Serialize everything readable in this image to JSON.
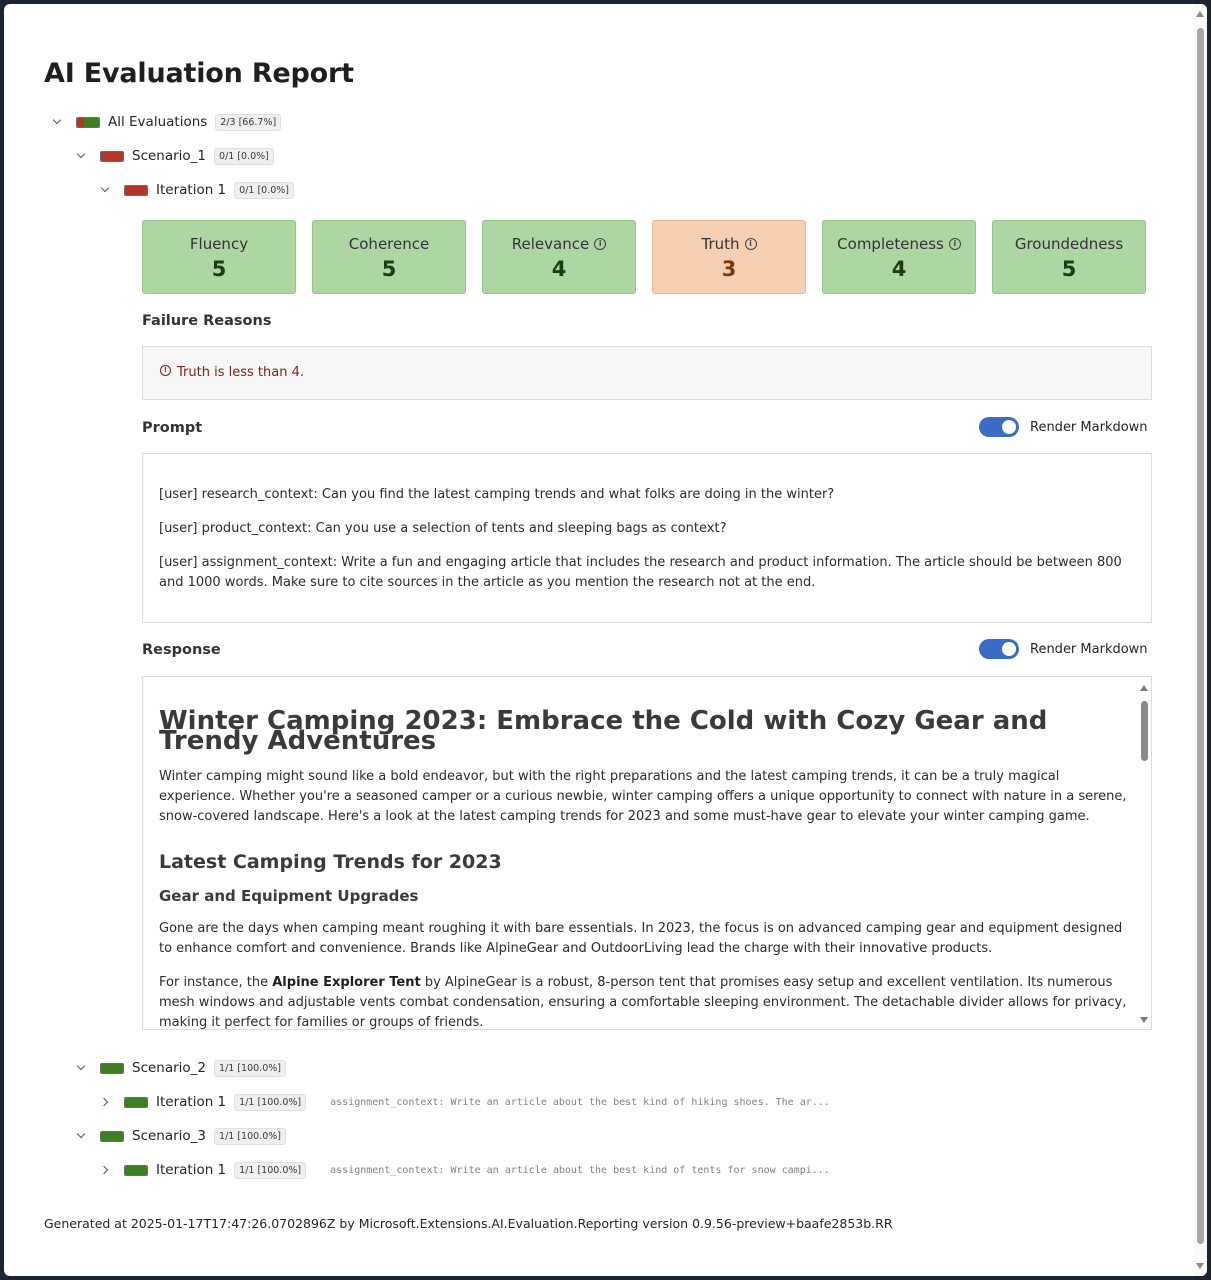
{
  "page_title": "AI Evaluation Report",
  "tree": {
    "root": {
      "label": "All Evaluations",
      "badge": "2/3 [66.7%]"
    },
    "scenario1": {
      "label": "Scenario_1",
      "badge": "0/1 [0.0%]"
    },
    "scenario1_iteration": {
      "label": "Iteration 1",
      "badge": "0/1 [0.0%]"
    },
    "scenario2": {
      "label": "Scenario_2",
      "badge": "1/1 [100.0%]"
    },
    "scenario2_iteration": {
      "label": "Iteration 1",
      "badge": "1/1 [100.0%]",
      "preview": "assignment_context: Write an article about the best kind of hiking shoes. The ar..."
    },
    "scenario3": {
      "label": "Scenario_3",
      "badge": "1/1 [100.0%]"
    },
    "scenario3_iteration": {
      "label": "Iteration 1",
      "badge": "1/1 [100.0%]",
      "preview": "assignment_context: Write an article about the best kind of tents for snow campi..."
    }
  },
  "metrics": [
    {
      "name": "Fluency",
      "score": "5",
      "status": "pass",
      "info": false
    },
    {
      "name": "Coherence",
      "score": "5",
      "status": "pass",
      "info": false
    },
    {
      "name": "Relevance",
      "score": "4",
      "status": "pass",
      "info": true
    },
    {
      "name": "Truth",
      "score": "3",
      "status": "fail",
      "info": true
    },
    {
      "name": "Completeness",
      "score": "4",
      "status": "pass",
      "info": true
    },
    {
      "name": "Groundedness",
      "score": "5",
      "status": "pass",
      "info": false
    }
  ],
  "failure": {
    "title": "Failure Reasons",
    "reason": "Truth is less than 4."
  },
  "prompt": {
    "title": "Prompt",
    "toggle_label": "Render Markdown",
    "lines": [
      "[user] research_context: Can you find the latest camping trends and what folks are doing in the winter?",
      "[user] product_context: Can you use a selection of tents and sleeping bags as context?",
      "[user] assignment_context: Write a fun and engaging article that includes the research and product information. The article should be between 800 and 1000 words. Make sure to cite sources in the article as you mention the research not at the end."
    ]
  },
  "response": {
    "title": "Response",
    "toggle_label": "Render Markdown",
    "heading": "Winter Camping 2023: Embrace the Cold with Cozy Gear and Trendy Adventures",
    "intro": "Winter camping might sound like a bold endeavor, but with the right preparations and the latest camping trends, it can be a truly magical experience. Whether you're a seasoned camper or a curious newbie, winter camping offers a unique opportunity to connect with nature in a serene, snow-covered landscape. Here's a look at the latest camping trends for 2023 and some must-have gear to elevate your winter camping game.",
    "section_heading": "Latest Camping Trends for 2023",
    "subsection_heading": "Gear and Equipment Upgrades",
    "paragraph1": "Gone are the days when camping meant roughing it with bare essentials. In 2023, the focus is on advanced camping gear and equipment designed to enhance comfort and convenience. Brands like AlpineGear and OutdoorLiving lead the charge with their innovative products.",
    "paragraph2_before": "For instance, the ",
    "paragraph2_bold": "Alpine Explorer Tent",
    "paragraph2_after": " by AlpineGear is a robust, 8-person tent that promises easy setup and excellent ventilation. Its numerous mesh windows and adjustable vents combat condensation, ensuring a comfortable sleeping environment. The detachable divider allows for privacy, making it perfect for families or groups of friends."
  },
  "footer": "Generated at 2025-01-17T17:47:26.0702896Z by Microsoft.Extensions.AI.Evaluation.Reporting version 0.9.56-preview+baafe2853b.RR",
  "colors": {
    "pass": "#acd6a2",
    "fail": "#f4cfb1",
    "bar_red": "#b5352a",
    "bar_green": "#3d7f22",
    "toggle": "#3a6cc7"
  }
}
